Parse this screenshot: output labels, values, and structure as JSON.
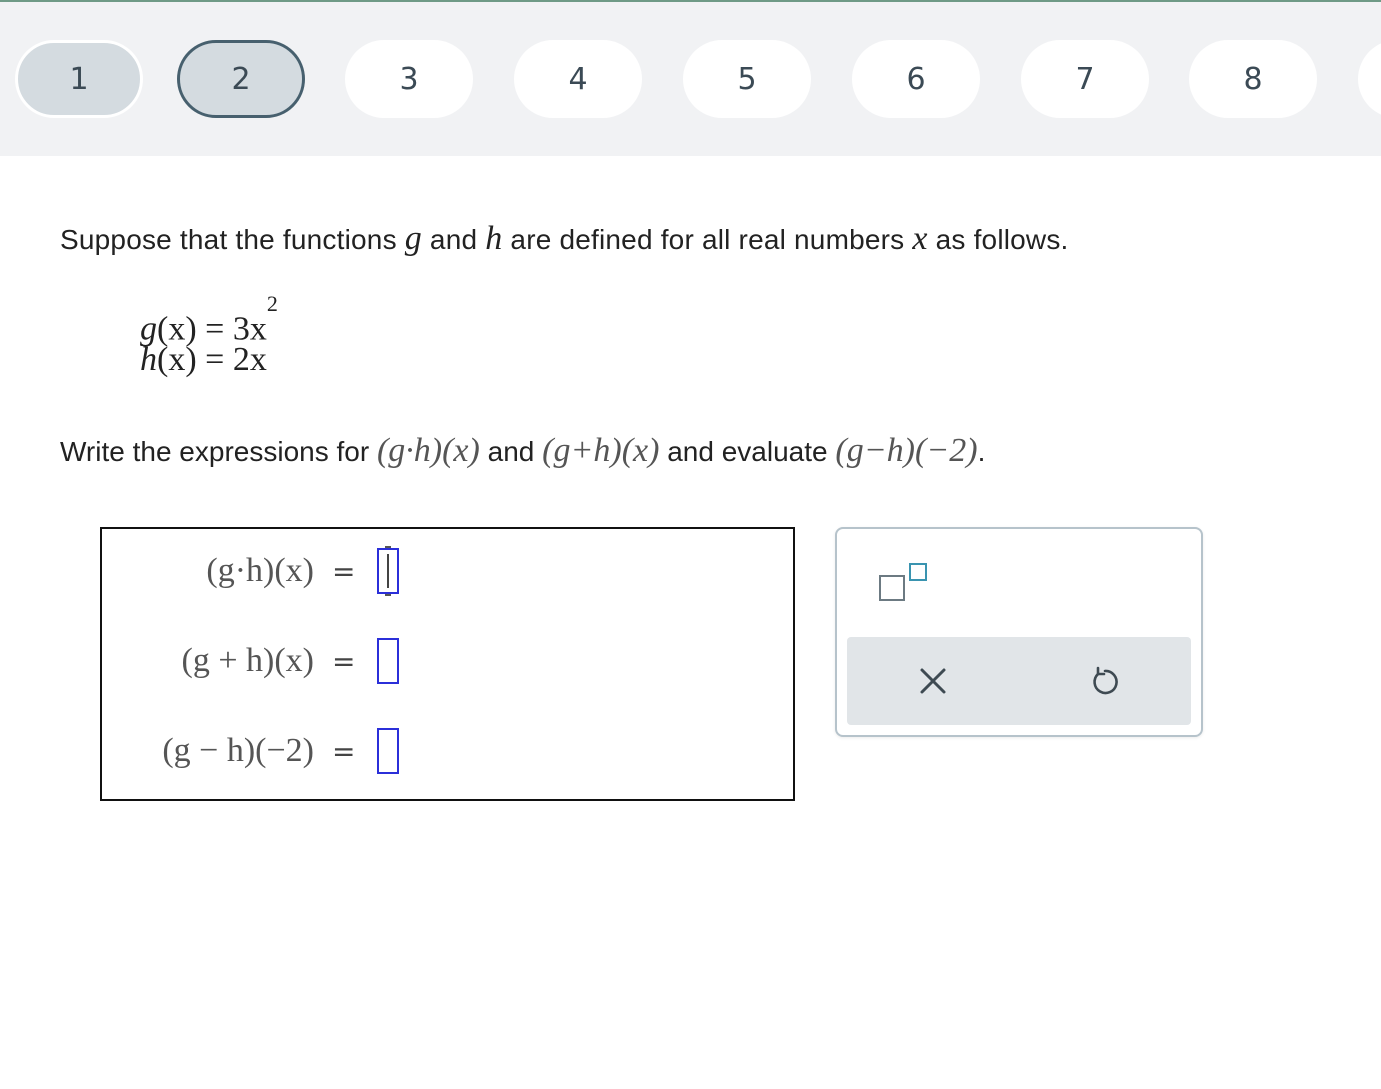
{
  "nav": {
    "questions": [
      {
        "label": "1",
        "state": "answered"
      },
      {
        "label": "2",
        "state": "current"
      },
      {
        "label": "3",
        "state": "unanswered"
      },
      {
        "label": "4",
        "state": "unanswered"
      },
      {
        "label": "5",
        "state": "unanswered"
      },
      {
        "label": "6",
        "state": "unanswered"
      },
      {
        "label": "7",
        "state": "unanswered"
      },
      {
        "label": "8",
        "state": "unanswered"
      }
    ],
    "colors": {
      "current_border": "#47606e",
      "answered_bg": "#d4dbe0",
      "bar_bg": "#f1f2f4"
    }
  },
  "problem": {
    "intro_pre": "Suppose that the functions ",
    "intro_g": "g",
    "intro_mid1": " and ",
    "intro_h": "h",
    "intro_mid2": " are defined for all real numbers ",
    "intro_x": "x",
    "intro_post": " as follows.",
    "def_g_lhs": "g",
    "def_g_rhs": "(x) = 3x",
    "def_g_exp": "2",
    "def_h_lhs": "h",
    "def_h_rhs": "(x) = 2x",
    "task_pre": "Write the expressions for ",
    "task_expr1": "(g·h)(x)",
    "task_and": " and ",
    "task_expr2": "(g+h)(x)",
    "task_mid": " and evaluate ",
    "task_expr3": "(g−h)(−2)",
    "task_post": "."
  },
  "answers": {
    "rows": [
      {
        "label": "(g·h)(x)",
        "equals": "=",
        "value": "",
        "active": true
      },
      {
        "label": "(g + h)(x)",
        "equals": "=",
        "value": "",
        "active": false
      },
      {
        "label": "(g − h)(−2)",
        "equals": "=",
        "value": "",
        "active": false
      }
    ],
    "slot_color": "#2b2fd9"
  },
  "palette": {
    "exponent_icon": "exponent-template-icon",
    "clear_icon": "close-x-icon",
    "undo_icon": "undo-icon",
    "accent": "#3a94b0"
  }
}
